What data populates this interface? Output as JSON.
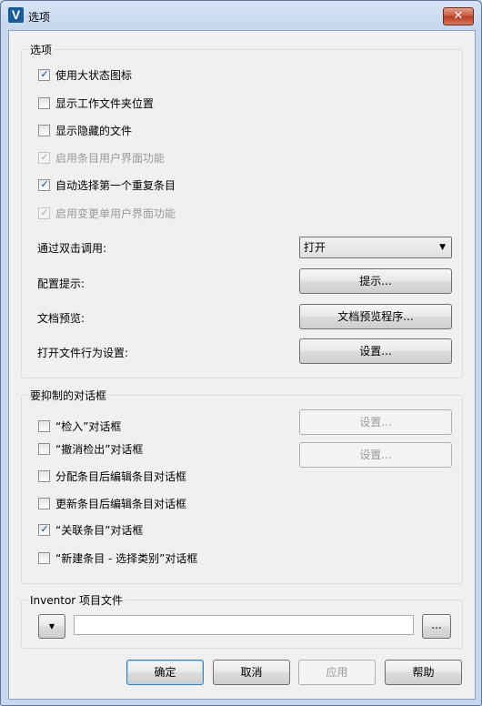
{
  "window": {
    "title": "选项",
    "close_label": "✕",
    "app_icon_letter": "V"
  },
  "options_group": {
    "label": "选项",
    "checkboxes": [
      {
        "label": "使用大状态图标",
        "checked": true,
        "enabled": true
      },
      {
        "label": "显示工作文件夹位置",
        "checked": false,
        "enabled": true
      },
      {
        "label": "显示隐藏的文件",
        "checked": false,
        "enabled": true
      },
      {
        "label": "启用条目用户界面功能",
        "checked": true,
        "enabled": false
      },
      {
        "label": "自动选择第一个重复条目",
        "checked": true,
        "enabled": true
      },
      {
        "label": "启用变更单用户界面功能",
        "checked": true,
        "enabled": false
      }
    ],
    "double_click_label": "通过双击调用:",
    "double_click_value": "打开",
    "config_hint_label": "配置提示:",
    "config_hint_button": "提示...",
    "doc_preview_label": "文档预览:",
    "doc_preview_button": "文档预览程序...",
    "open_file_label": "打开文件行为设置:",
    "open_file_button": "设置..."
  },
  "suppress_group": {
    "label": "要抑制的对话框",
    "checkboxes": [
      {
        "label": "“检入”对话框",
        "checked": false,
        "enabled": true
      },
      {
        "label": "“撤消检出”对话框",
        "checked": false,
        "enabled": true
      },
      {
        "label": "分配条目后编辑条目对话框",
        "checked": false,
        "enabled": true
      },
      {
        "label": "更新条目后编辑条目对话框",
        "checked": false,
        "enabled": true
      },
      {
        "label": "“关联条目”对话框",
        "checked": true,
        "enabled": true
      },
      {
        "label": "“新建条目 - 选择类别”对话框",
        "checked": false,
        "enabled": true
      }
    ],
    "settings_button_1": "设置...",
    "settings_button_2": "设置..."
  },
  "inventor_group": {
    "label": "Inventor 项目文件",
    "path_value": "",
    "browse_button": "..."
  },
  "footer": {
    "ok": "确定",
    "cancel": "取消",
    "apply": "应用",
    "help": "帮助"
  },
  "check_glyph": "✓",
  "dropdown_arrow": "▼"
}
